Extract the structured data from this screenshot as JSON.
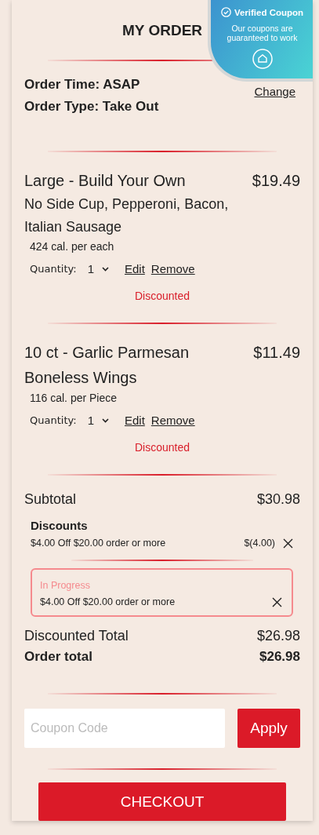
{
  "title": "MY ORDER",
  "badge": {
    "title": "Verified Coupon",
    "text": "Our coupons are guaranteed to work"
  },
  "order_info": {
    "time": "Order Time: ASAP",
    "type": "Order Type: Take Out",
    "change": "Change"
  },
  "items": [
    {
      "name": "Large - Build Your Own",
      "price": "$19.49",
      "details": "No Side Cup, Pepperoni, Bacon, Italian Sausage",
      "calories": "424 cal. per each",
      "quantity_label": "Quantity:",
      "quantity": "1",
      "edit": "Edit",
      "remove": "Remove",
      "status": "Discounted"
    },
    {
      "name": "10 ct - Garlic Parmesan Boneless Wings",
      "price": "$11.49",
      "calories": "116 cal. per Piece",
      "quantity_label": "Quantity:",
      "quantity": "1",
      "edit": "Edit",
      "remove": "Remove",
      "status": "Discounted"
    }
  ],
  "subtotal": {
    "label": "Subtotal",
    "value": "$30.98"
  },
  "discounts": {
    "title": "Discounts",
    "items": [
      {
        "text": "$4.00 Off $20.00 order or more",
        "amount": "$(4.00)"
      }
    ]
  },
  "in_progress": {
    "label": "In Progress",
    "text": "$4.00 Off $20.00 order or more"
  },
  "discounted_total": {
    "label": "Discounted Total",
    "value": "$26.98"
  },
  "order_total": {
    "label": "Order total",
    "value": "$26.98"
  },
  "coupon": {
    "placeholder": "Coupon Code",
    "button": "Apply"
  },
  "checkout": "CHECKOUT"
}
